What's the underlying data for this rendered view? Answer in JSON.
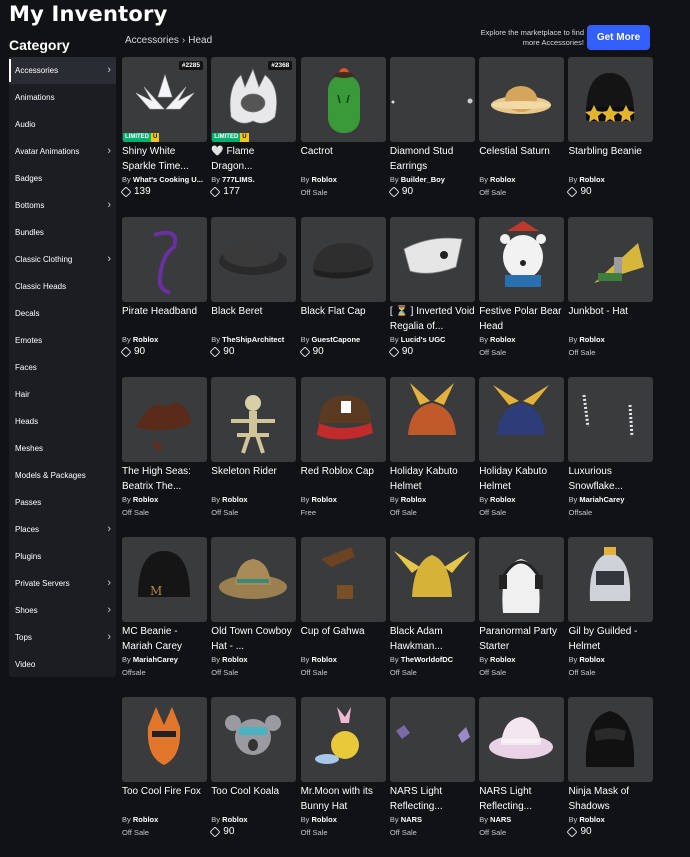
{
  "page": {
    "title": "My Inventory"
  },
  "sidebar": {
    "heading": "Category",
    "items": [
      {
        "label": "Accessories",
        "chevron": true,
        "active": true
      },
      {
        "label": "Animations",
        "chevron": false
      },
      {
        "label": "Audio",
        "chevron": false
      },
      {
        "label": "Avatar Animations",
        "chevron": true
      },
      {
        "label": "Badges",
        "chevron": false
      },
      {
        "label": "Bottoms",
        "chevron": true
      },
      {
        "label": "Bundles",
        "chevron": false
      },
      {
        "label": "Classic Clothing",
        "chevron": true
      },
      {
        "label": "Classic Heads",
        "chevron": false
      },
      {
        "label": "Decals",
        "chevron": false
      },
      {
        "label": "Emotes",
        "chevron": false
      },
      {
        "label": "Faces",
        "chevron": false
      },
      {
        "label": "Hair",
        "chevron": false
      },
      {
        "label": "Heads",
        "chevron": false
      },
      {
        "label": "Meshes",
        "chevron": false
      },
      {
        "label": "Models & Packages",
        "chevron": false
      },
      {
        "label": "Passes",
        "chevron": false
      },
      {
        "label": "Places",
        "chevron": true
      },
      {
        "label": "Plugins",
        "chevron": false
      },
      {
        "label": "Private Servers",
        "chevron": true
      },
      {
        "label": "Shoes",
        "chevron": true
      },
      {
        "label": "Tops",
        "chevron": true
      },
      {
        "label": "Video",
        "chevron": false
      }
    ]
  },
  "breadcrumb": {
    "parent": "Accessories",
    "separator": "›",
    "current": "Head"
  },
  "marketplace": {
    "text": "Explore the marketplace to find more Accessories!",
    "button_label": "Get More"
  },
  "colors": {
    "accent": "#335fff",
    "limited": "#00b06f",
    "unique": "#f5c518",
    "card_bg": "#393b3d"
  },
  "items": [
    {
      "name": "Shiny White Sparkle Time...",
      "by": "By",
      "creator": "What's Cooking U...",
      "price": "139",
      "status": "",
      "serial": "#2285",
      "limited": true,
      "icon": "white-sparkle-wings-icon"
    },
    {
      "name": "🤍 Flame Dragon...",
      "by": "By",
      "creator": "777LIMS.",
      "price": "177",
      "status": "",
      "serial": "#2368",
      "limited": true,
      "icon": "flame-dragon-icon"
    },
    {
      "name": "Cactrot",
      "by": "By",
      "creator": "Roblox",
      "price": "",
      "status": "Off Sale",
      "serial": "",
      "limited": false,
      "icon": "cactus-icon"
    },
    {
      "name": "Diamond Stud Earrings",
      "by": "By",
      "creator": "Builder_Boy",
      "price": "90",
      "status": "",
      "serial": "",
      "limited": false,
      "icon": "earrings-icon"
    },
    {
      "name": "Celestial Saturn",
      "by": "By",
      "creator": "Roblox",
      "price": "",
      "status": "Off Sale",
      "serial": "",
      "limited": false,
      "icon": "saturn-icon"
    },
    {
      "name": "Starbling Beanie",
      "by": "By",
      "creator": "Roblox",
      "price": "90",
      "status": "",
      "serial": "",
      "limited": false,
      "icon": "beanie-stars-icon"
    },
    {
      "name": "Pirate Headband",
      "by": "By",
      "creator": "Roblox",
      "price": "90",
      "status": "",
      "serial": "",
      "limited": false,
      "icon": "headband-icon"
    },
    {
      "name": "Black Beret",
      "by": "By",
      "creator": "TheShipArchitect",
      "price": "90",
      "status": "",
      "serial": "",
      "limited": false,
      "icon": "beret-icon"
    },
    {
      "name": "Black Flat Cap",
      "by": "By",
      "creator": "GuestCapone",
      "price": "90",
      "status": "",
      "serial": "",
      "limited": false,
      "icon": "flat-cap-icon"
    },
    {
      "name": "[ ⏳ ] Inverted Void Regalia of...",
      "by": "By",
      "creator": "Lucid's UGC",
      "price": "90",
      "status": "",
      "serial": "",
      "limited": false,
      "icon": "void-regalia-icon"
    },
    {
      "name": "Festive Polar Bear Head",
      "by": "By",
      "creator": "Roblox",
      "price": "",
      "status": "Off Sale",
      "serial": "",
      "limited": false,
      "icon": "polar-bear-icon"
    },
    {
      "name": "Junkbot - Hat",
      "by": "By",
      "creator": "Roblox",
      "price": "",
      "status": "Off Sale",
      "serial": "",
      "limited": false,
      "icon": "junkbot-hat-icon"
    },
    {
      "name": "The High Seas: Beatrix The...",
      "by": "By",
      "creator": "Roblox",
      "price": "",
      "status": "Off Sale",
      "serial": "",
      "limited": false,
      "icon": "pirate-hat-icon"
    },
    {
      "name": "Skeleton Rider",
      "by": "By",
      "creator": "Roblox",
      "price": "",
      "status": "Off Sale",
      "serial": "",
      "limited": false,
      "icon": "skeleton-icon"
    },
    {
      "name": "Red Roblox Cap",
      "by": "By",
      "creator": "Roblox",
      "price": "",
      "status": "Free",
      "serial": "",
      "limited": false,
      "icon": "red-cap-icon"
    },
    {
      "name": "Holiday Kabuto Helmet",
      "by": "By",
      "creator": "Roblox",
      "price": "",
      "status": "Off Sale",
      "serial": "",
      "limited": false,
      "icon": "kabuto-helmet-icon"
    },
    {
      "name": "Holiday Kabuto Helmet",
      "by": "By",
      "creator": "Roblox",
      "price": "",
      "status": "Off Sale",
      "serial": "",
      "limited": false,
      "icon": "kabuto-helmet-blue-icon"
    },
    {
      "name": "Luxurious Snowflake...",
      "by": "By",
      "creator": "MariahCarey",
      "price": "",
      "status": "Offsale",
      "serial": "",
      "limited": false,
      "icon": "snowflake-earrings-icon"
    },
    {
      "name": "MC Beanie - Mariah Carey",
      "by": "By",
      "creator": "MariahCarey",
      "price": "",
      "status": "Offsale",
      "serial": "",
      "limited": false,
      "icon": "mc-beanie-icon"
    },
    {
      "name": "Old Town Cowboy Hat - ...",
      "by": "By",
      "creator": "Roblox",
      "price": "",
      "status": "Off Sale",
      "serial": "",
      "limited": false,
      "icon": "cowboy-hat-icon"
    },
    {
      "name": "Cup of Gahwa",
      "by": "By",
      "creator": "Roblox",
      "price": "",
      "status": "Off Sale",
      "serial": "",
      "limited": false,
      "icon": "coffee-cup-icon"
    },
    {
      "name": "Black Adam Hawkman...",
      "by": "By",
      "creator": "TheWorldofDC",
      "price": "",
      "status": "Off Sale",
      "serial": "",
      "limited": false,
      "icon": "hawkman-helmet-icon"
    },
    {
      "name": "Paranormal Party Starter",
      "by": "By",
      "creator": "Roblox",
      "price": "",
      "status": "Off Sale",
      "serial": "",
      "limited": false,
      "icon": "ghost-headphones-icon"
    },
    {
      "name": "Gil by Guilded - Helmet",
      "by": "By",
      "creator": "Roblox",
      "price": "",
      "status": "Off Sale",
      "serial": "",
      "limited": false,
      "icon": "knight-helmet-icon"
    },
    {
      "name": "Too Cool Fire Fox",
      "by": "By",
      "creator": "Roblox",
      "price": "",
      "status": "Off Sale",
      "serial": "",
      "limited": false,
      "icon": "fire-fox-icon"
    },
    {
      "name": "Too Cool Koala",
      "by": "By",
      "creator": "Roblox",
      "price": "90",
      "status": "",
      "serial": "",
      "limited": false,
      "icon": "koala-icon"
    },
    {
      "name": "Mr.Moon with its Bunny Hat",
      "by": "By",
      "creator": "Roblox",
      "price": "",
      "status": "Off Sale",
      "serial": "",
      "limited": false,
      "icon": "moon-bunny-icon"
    },
    {
      "name": "NARS Light Reflecting...",
      "by": "By",
      "creator": "NARS",
      "price": "",
      "status": "Off Sale",
      "serial": "",
      "limited": false,
      "icon": "crystals-icon"
    },
    {
      "name": "NARS Light Reflecting...",
      "by": "By",
      "creator": "NARS",
      "price": "",
      "status": "Off Sale",
      "serial": "",
      "limited": false,
      "icon": "bucket-hat-icon"
    },
    {
      "name": "Ninja Mask of Shadows",
      "by": "By",
      "creator": "Roblox",
      "price": "90",
      "status": "",
      "serial": "",
      "limited": false,
      "icon": "ninja-mask-icon"
    }
  ]
}
